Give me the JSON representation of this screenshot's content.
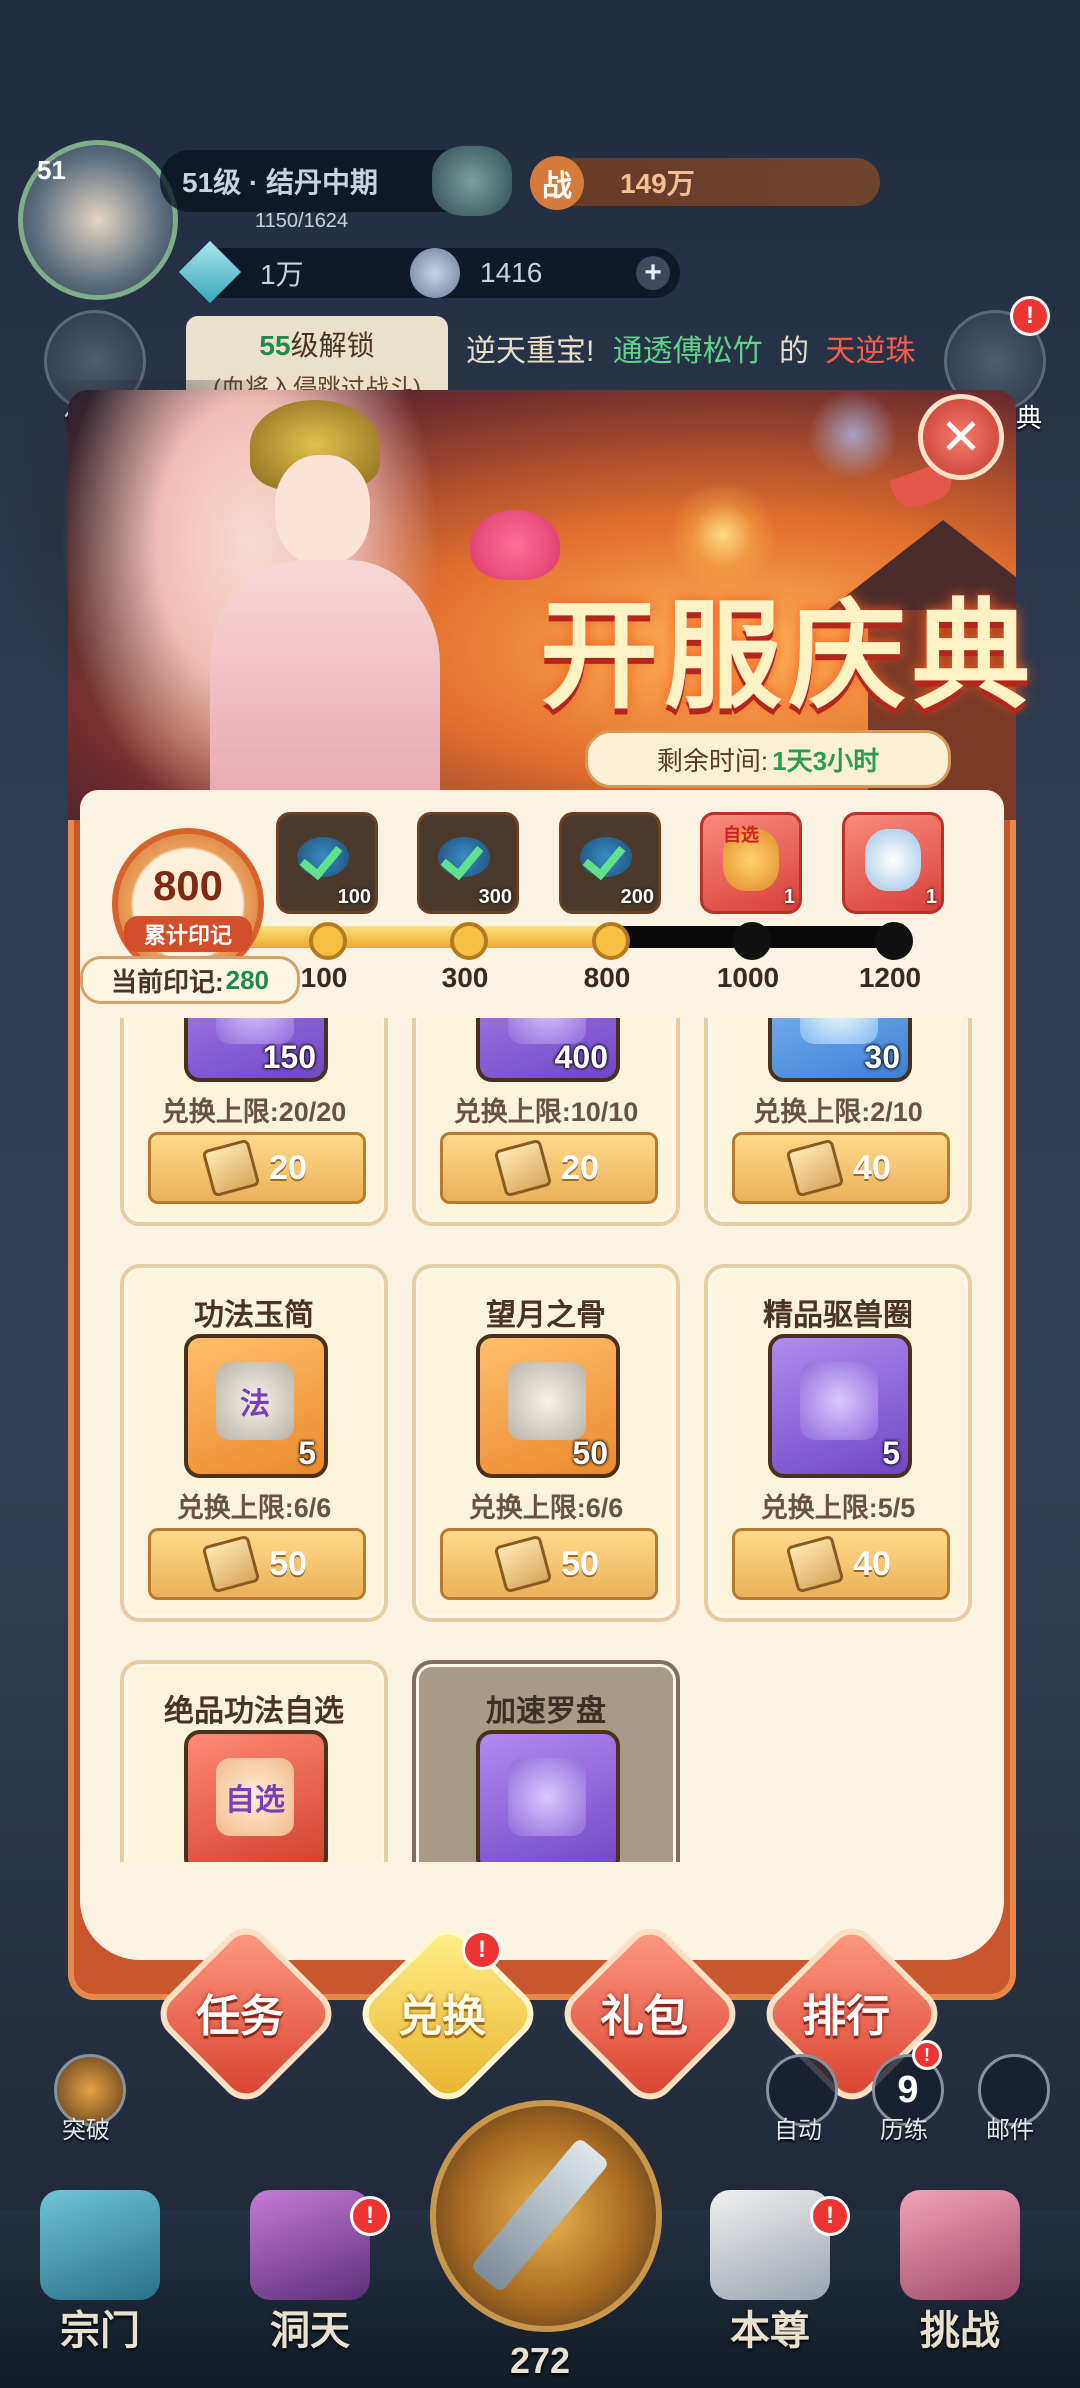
{
  "hud": {
    "level_badge": "51",
    "level_title": "51级 · 结丹中期",
    "exp": "1150/1624",
    "power_icon_char": "战",
    "power": "149万",
    "currency1": "1万",
    "currency2": "1416",
    "plus": "+",
    "unlock_level": "55",
    "unlock_text": "级解锁",
    "unlock_sub": "(血将入侵跳过战斗)",
    "news_prefix": "逆天重宝!",
    "news_user": "通透傅松竹",
    "news_mid": "的",
    "news_item": "天逆珠",
    "side_left_label": "仙途",
    "side_right_label": "庆典"
  },
  "modal": {
    "title": "开服庆典",
    "close": "✕",
    "timer_label": "剩余时间:",
    "timer_value": "1天3小时",
    "marks_total": "800",
    "marks_label": "累计印记",
    "current_label": "当前印记:",
    "current_value": "280",
    "progress": {
      "current": 800,
      "max": 1200,
      "milestones": [
        {
          "value": "100",
          "count": "100",
          "claimed": true
        },
        {
          "value": "300",
          "count": "300",
          "claimed": true
        },
        {
          "value": "800",
          "count": "200",
          "claimed": true
        },
        {
          "value": "1000",
          "count": "1",
          "claimed": false,
          "badge": "自选"
        },
        {
          "value": "1200",
          "count": "1",
          "claimed": false
        }
      ]
    },
    "items": [
      {
        "name": "",
        "qty": "150",
        "limit": "兑换上限:20/20",
        "price": "20",
        "color": "purple"
      },
      {
        "name": "",
        "qty": "400",
        "limit": "兑换上限:10/10",
        "price": "20",
        "color": "purple"
      },
      {
        "name": "",
        "qty": "30",
        "limit": "兑换上限:2/10",
        "price": "40",
        "color": "blue"
      },
      {
        "name": "功法玉简",
        "qty": "5",
        "limit": "兑换上限:6/6",
        "price": "50",
        "color": "orange",
        "glyph": "法"
      },
      {
        "name": "望月之骨",
        "qty": "50",
        "limit": "兑换上限:6/6",
        "price": "50",
        "color": "orange"
      },
      {
        "name": "精品驱兽圈",
        "qty": "5",
        "limit": "兑换上限:5/5",
        "price": "40",
        "color": "purple"
      },
      {
        "name": "绝品功法自选",
        "qty": "",
        "limit": "",
        "price": "",
        "color": "red",
        "glyph": "自选"
      },
      {
        "name": "加速罗盘",
        "qty": "",
        "limit": "",
        "price": "",
        "color": "purple",
        "locked": true
      }
    ],
    "tabs": [
      {
        "label": "任务",
        "active": false
      },
      {
        "label": "兑换",
        "active": true,
        "badge": "!"
      },
      {
        "label": "礼包",
        "active": false
      },
      {
        "label": "排行",
        "active": false
      }
    ]
  },
  "bottom": {
    "breakthrough": "突破",
    "auto": "自动",
    "trial": "历练",
    "trial_count": "9",
    "mail": "邮件",
    "nav": [
      "宗门",
      "洞天",
      "本尊",
      "挑战"
    ],
    "center_value": "272",
    "badge": "!"
  },
  "colors": {
    "modal_red": "#c8572e",
    "panel_cream": "#fbf3e2",
    "accent_green": "#1f8a4a",
    "gold": "#f6c044"
  }
}
